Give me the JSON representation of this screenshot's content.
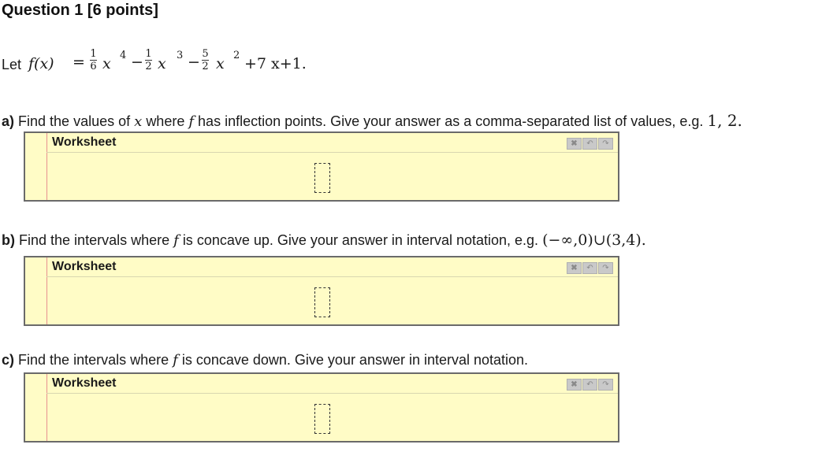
{
  "title": "Question 1 [6 points]",
  "function": {
    "let": "Let",
    "lhs": "f(x)",
    "eq": "=",
    "frac1_num": "1",
    "frac1_den": "6",
    "frac2_num": "1",
    "frac2_den": "2",
    "frac3_num": "5",
    "frac3_den": "2",
    "x": "x",
    "exp4": "4",
    "exp3": "3",
    "exp2": "2",
    "minus": "−",
    "tail": "+7 x+1."
  },
  "parts": [
    {
      "label": "a)",
      "text_before": "Find the values of",
      "var": "x",
      "text_mid": "where",
      "func": "f",
      "text_after": "has inflection points. Give your answer as a comma-separated list of values, e.g.",
      "example": "1, 2.",
      "worksheet_label": "Worksheet"
    },
    {
      "label": "b)",
      "text_before": "Find the intervals where",
      "func": "f",
      "text_after": "is concave up. Give your answer in interval notation, e.g.",
      "example": "(−∞,0)∪(3,4).",
      "worksheet_label": "Worksheet"
    },
    {
      "label": "c)",
      "text_before": "Find the intervals where",
      "func": "f",
      "text_after": "is concave down. Give your answer in interval notation.",
      "worksheet_label": "Worksheet"
    }
  ],
  "toolbar_icons": [
    "clear-icon",
    "undo-icon",
    "redo-icon"
  ],
  "colors": {
    "worksheet_bg": "#fffcc6",
    "worksheet_border": "#6a6a6a",
    "margin_line": "#e89090"
  }
}
